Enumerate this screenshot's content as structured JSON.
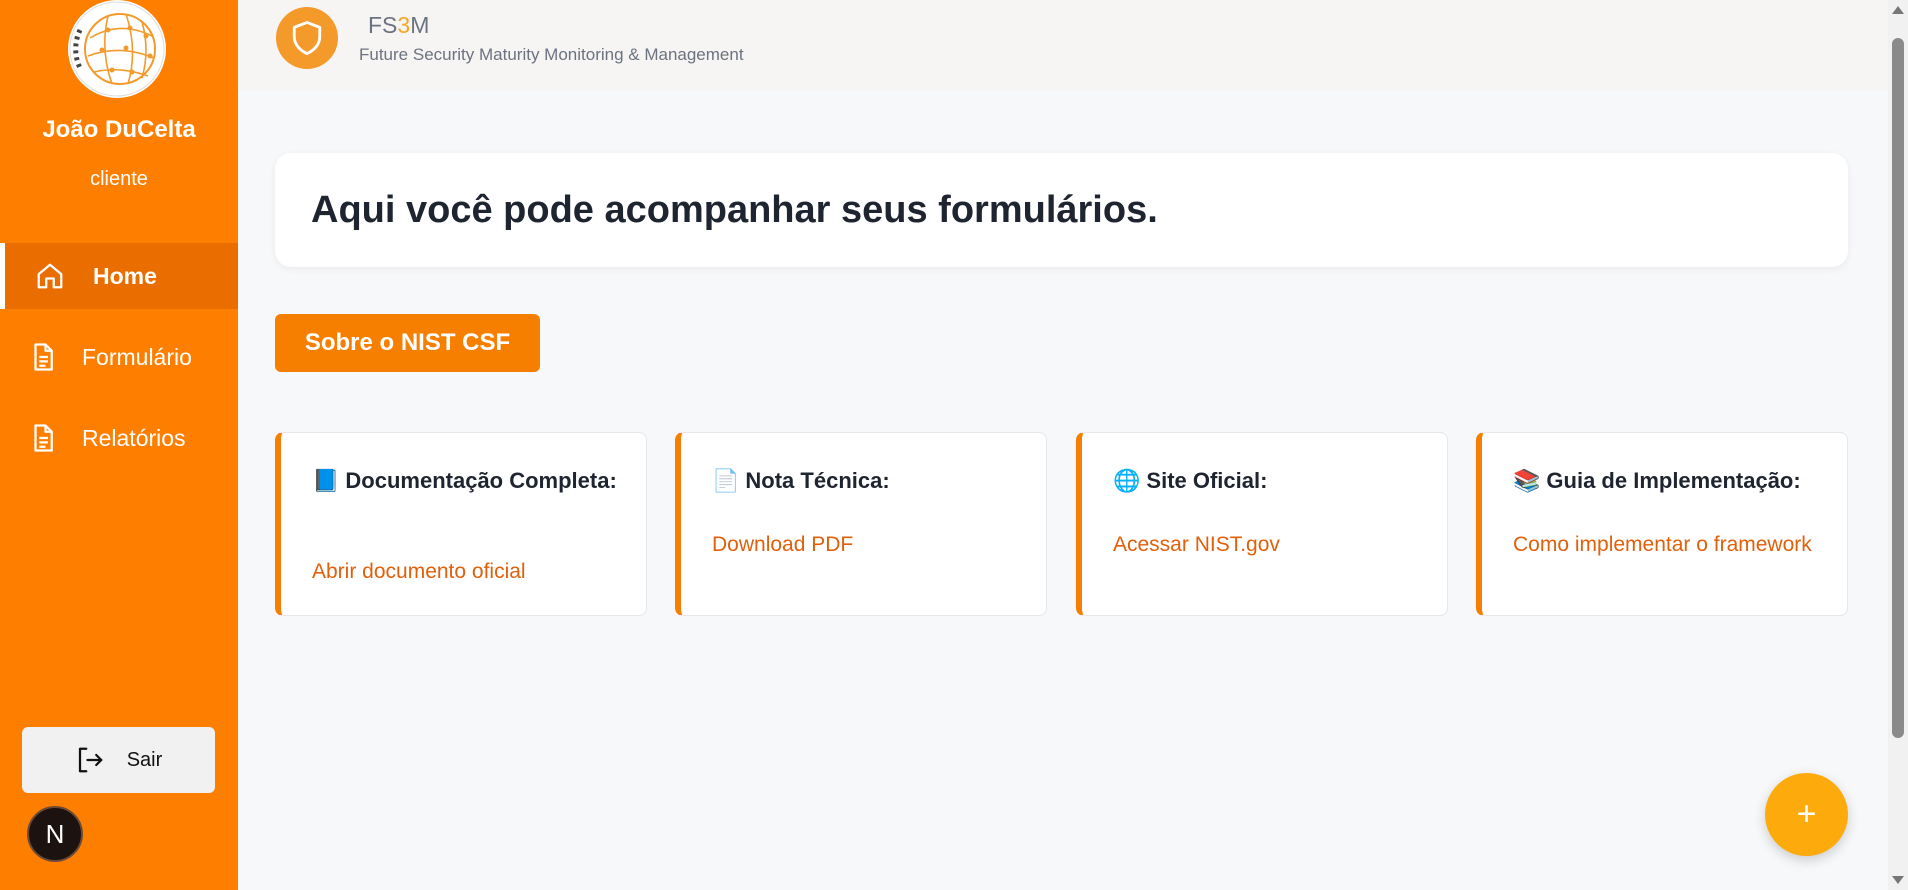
{
  "user": {
    "name": "João DuCelta",
    "role": "cliente"
  },
  "sidebar": {
    "items": [
      {
        "label": "Home",
        "icon": "home-icon",
        "active": true
      },
      {
        "label": "Formulário",
        "icon": "document-icon",
        "active": false
      },
      {
        "label": "Relatórios",
        "icon": "document-icon",
        "active": false
      }
    ],
    "logout_label": "Sair",
    "badge_letter": "N"
  },
  "header": {
    "brand_prefix": "FS",
    "brand_highlight": "3",
    "brand_suffix": "M",
    "subtitle": "Future Security Maturity Monitoring & Management"
  },
  "main": {
    "hero_title": "Aqui você pode acompanhar seus formulários.",
    "nist_button": "Sobre o NIST CSF",
    "cards": [
      {
        "emoji": "📘",
        "title": "Documentação Completa:",
        "link": "Abrir documento oficial"
      },
      {
        "emoji": "📄",
        "title": "Nota Técnica:",
        "link": "Download PDF"
      },
      {
        "emoji": "🌐",
        "title": "Site Oficial:",
        "link": "Acessar NIST.gov"
      },
      {
        "emoji": "📚",
        "title": "Guia de Implementação:",
        "link": "Como implementar o framework"
      }
    ],
    "fab_label": "+"
  },
  "colors": {
    "sidebar": "#fe7f00",
    "accent": "#f77f00",
    "link": "#e1600b",
    "fab": "#fdab0c"
  }
}
